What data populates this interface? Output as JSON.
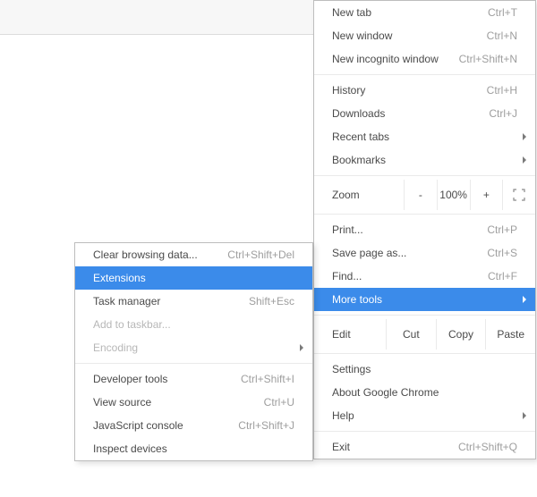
{
  "mainMenu": {
    "newTab": {
      "label": "New tab",
      "shortcut": "Ctrl+T"
    },
    "newWindow": {
      "label": "New window",
      "shortcut": "Ctrl+N"
    },
    "newIncognito": {
      "label": "New incognito window",
      "shortcut": "Ctrl+Shift+N"
    },
    "history": {
      "label": "History",
      "shortcut": "Ctrl+H"
    },
    "downloads": {
      "label": "Downloads",
      "shortcut": "Ctrl+J"
    },
    "recentTabs": {
      "label": "Recent tabs"
    },
    "bookmarks": {
      "label": "Bookmarks"
    },
    "zoom": {
      "label": "Zoom",
      "minus": "-",
      "value": "100%",
      "plus": "+"
    },
    "print": {
      "label": "Print...",
      "shortcut": "Ctrl+P"
    },
    "savePage": {
      "label": "Save page as...",
      "shortcut": "Ctrl+S"
    },
    "find": {
      "label": "Find...",
      "shortcut": "Ctrl+F"
    },
    "moreTools": {
      "label": "More tools"
    },
    "edit": {
      "label": "Edit",
      "cut": "Cut",
      "copy": "Copy",
      "paste": "Paste"
    },
    "settings": {
      "label": "Settings"
    },
    "about": {
      "label": "About Google Chrome"
    },
    "help": {
      "label": "Help"
    },
    "exit": {
      "label": "Exit",
      "shortcut": "Ctrl+Shift+Q"
    }
  },
  "subMenu": {
    "clearData": {
      "label": "Clear browsing data...",
      "shortcut": "Ctrl+Shift+Del"
    },
    "extensions": {
      "label": "Extensions"
    },
    "taskManager": {
      "label": "Task manager",
      "shortcut": "Shift+Esc"
    },
    "addTaskbar": {
      "label": "Add to taskbar..."
    },
    "encoding": {
      "label": "Encoding"
    },
    "devTools": {
      "label": "Developer tools",
      "shortcut": "Ctrl+Shift+I"
    },
    "viewSource": {
      "label": "View source",
      "shortcut": "Ctrl+U"
    },
    "jsConsole": {
      "label": "JavaScript console",
      "shortcut": "Ctrl+Shift+J"
    },
    "inspect": {
      "label": "Inspect devices"
    }
  }
}
